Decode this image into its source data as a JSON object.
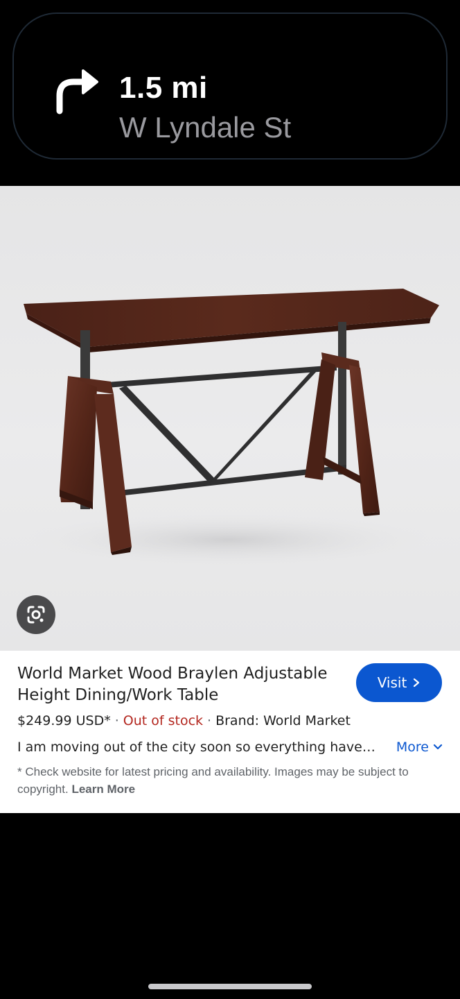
{
  "navigation": {
    "distance": "1.5 mi",
    "street": "W Lyndale St",
    "turn_icon": "turn-right-arrow-icon"
  },
  "image": {
    "lens_icon": "google-lens-icon"
  },
  "product": {
    "title": "World Market Wood Braylen Adjustable Height Dining/Work Table",
    "visit_label": "Visit",
    "price": "$249.99 USD*",
    "separator": "·",
    "stock_status": "Out of stock",
    "brand": "Brand: World Market",
    "description": "I am moving out of the city soon so everything have…",
    "more_label": "More",
    "disclaimer": "* Check website for latest pricing and availability. Images may be subject to copyright.",
    "learn_more_label": "Learn More"
  },
  "colors": {
    "accent": "#0b57d0",
    "out_of_stock": "#b3261e",
    "background": "#000000"
  }
}
